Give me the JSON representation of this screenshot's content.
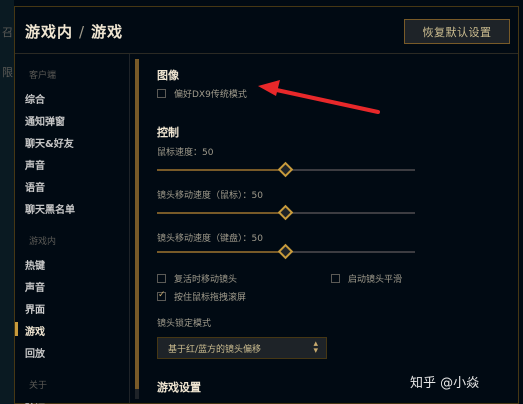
{
  "left_fragments": [
    "召",
    "限"
  ],
  "header": {
    "breadcrumb_parent": "游戏内",
    "separator": "/",
    "breadcrumb_current": "游戏",
    "reset_button": "恢复默认设置"
  },
  "sidebar": {
    "group_client": "客户端",
    "client_items": [
      "综合",
      "通知弹窗",
      "聊天&好友",
      "声音",
      "语音",
      "聊天黑名单"
    ],
    "group_ingame": "游戏内",
    "ingame_items": [
      "热键",
      "声音",
      "界面",
      "游戏",
      "回放"
    ],
    "active_item": "游戏",
    "group_about": "关于",
    "about_items": [
      "验证"
    ]
  },
  "content": {
    "graphics_title": "图像",
    "prefer_dx9_label": "偏好DX9传统模式",
    "prefer_dx9_checked": false,
    "control_title": "控制",
    "sliders": [
      {
        "label": "鼠标速度：50",
        "value": 50
      },
      {
        "label": "镜头移动速度（鼠标）：50",
        "value": 50
      },
      {
        "label": "镜头移动速度（键盘）：50",
        "value": 50
      }
    ],
    "checkboxes": [
      {
        "label": "复活时移动镜头",
        "checked": false
      },
      {
        "label": "启动镜头平滑",
        "checked": false
      },
      {
        "label": "按住鼠标拖拽滚屏",
        "checked": true
      }
    ],
    "camera_lock_label": "镜头锁定模式",
    "camera_lock_value": "基于红/蓝方的镜头偏移",
    "gameplay_title": "游戏设置"
  },
  "watermark": "知乎 @小焱",
  "colors": {
    "background": "#010a13",
    "gold": "#c89b3c",
    "text": "#a09b8c",
    "heading": "#f0e6d2",
    "arrow": "#e8282a"
  }
}
